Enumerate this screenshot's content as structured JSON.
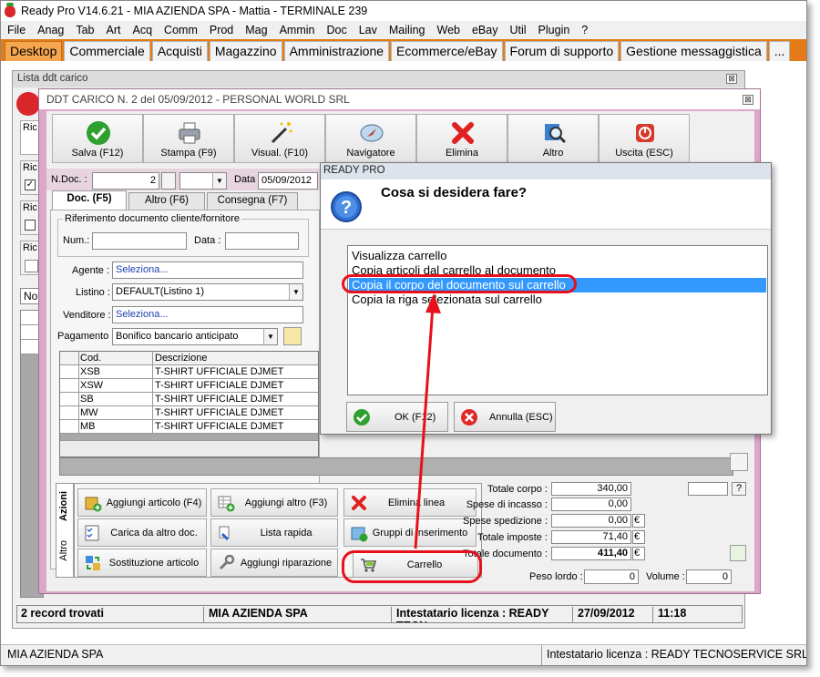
{
  "app": {
    "title": "Ready Pro V14.6.21 - MIA AZIENDA SPA - Mattia - TERMINALE 239",
    "menu": [
      "File",
      "Anag",
      "Tab",
      "Art",
      "Acq",
      "Comm",
      "Prod",
      "Mag",
      "Ammin",
      "Doc",
      "Lav",
      "Mailing",
      "Web",
      "eBay",
      "Util",
      "Plugin",
      "?"
    ],
    "tabs": [
      "Desktop",
      "Commerciale",
      "Acquisti",
      "Magazzino",
      "Amministrazione",
      "Ecommerce/eBay",
      "Forum di supporto",
      "Gestione messaggistica",
      "..."
    ],
    "bottom_company": "MIA AZIENDA SPA",
    "bottom_license": "Intestatario licenza : READY TECNOSERVICE SRL"
  },
  "lista": {
    "title": "Lista ddt carico",
    "filter_labels": [
      "Ric",
      "Ric",
      "Ric",
      "Ric"
    ],
    "no_label": "No",
    "status": {
      "records": "2 record trovati",
      "company": "MIA AZIENDA SPA",
      "license": "Intestatario licenza : READY TECN",
      "date": "27/09/2012",
      "time": "11:18"
    }
  },
  "ddt": {
    "title": "DDT CARICO N. 2  del 05/09/2012 - PERSONAL WORLD SRL",
    "toolbar": {
      "save": "Salva (F12)",
      "print": "Stampa (F9)",
      "visual": "Visual. (F10)",
      "nav": "Navigatore",
      "delete": "Elimina",
      "other": "Altro",
      "exit": "Uscita (ESC)"
    },
    "ndoc_label": "N.Doc. :",
    "ndoc_value": "2",
    "data_label": "Data :",
    "data_value": "05/09/2012",
    "subtabs": [
      "Doc. (F5)",
      "Altro (F6)",
      "Consegna (F7)"
    ],
    "rif_legend": "Riferimento documento cliente/fornitore",
    "num_label": "Num.:",
    "data2_label": "Data :",
    "agente_label": "Agente :",
    "agente_value": "Seleziona...",
    "listino_label": "Listino :",
    "listino_value": "DEFAULT(Listino 1)",
    "venditore_label": "Venditore :",
    "venditore_value": "Seleziona...",
    "pagamento_label": "Pagamento :",
    "pagamento_value": "Bonifico bancario anticipato",
    "grid": {
      "headers": [
        "Cod.",
        "Descrizione"
      ],
      "rows": [
        {
          "cod": "XSB",
          "desc": "T-SHIRT UFFICIALE DJMET"
        },
        {
          "cod": "XSW",
          "desc": "T-SHIRT UFFICIALE DJMET"
        },
        {
          "cod": "SB",
          "desc": "T-SHIRT UFFICIALE DJMET"
        },
        {
          "cod": "MW",
          "desc": "T-SHIRT UFFICIALE DJMET"
        },
        {
          "cod": "MB",
          "desc": "T-SHIRT UFFICIALE DJMET"
        }
      ]
    },
    "side_tabs": [
      "Azioni",
      "Altro"
    ],
    "actions": {
      "add_article": "Aggiungi articolo (F4)",
      "add_other": "Aggiungi altro (F3)",
      "delete_line": "Elimina linea",
      "load_other": "Carica da altro doc.",
      "quick_list": "Lista rapida",
      "groups": "Gruppi di inserimento",
      "replace": "Sostituzione articolo",
      "repair": "Aggiungi riparazione",
      "cart": "Carrello"
    },
    "totals": {
      "corpo_label": "Totale corpo :",
      "corpo": "340,00",
      "incasso_label": "Spese di incasso :",
      "incasso": "0,00",
      "spedizione_label": "Spese spedizione :",
      "spedizione": "0,00",
      "imposte_label": "Totale imposte :",
      "imposte": "71,40",
      "documento_label": "Totale documento :",
      "documento": "411,40",
      "currency": "€",
      "help": "?",
      "peso_label": "Peso lordo :",
      "peso": "0",
      "volume_label": "Volume :",
      "volume": "0"
    }
  },
  "dialog": {
    "title": "READY PRO",
    "question": "Cosa si desidera fare?",
    "options": [
      "Visualizza carrello",
      "Copia articoli dal carrello al documento",
      "Copia il corpo del documento sul carrello",
      "Copia la riga selezionata sul carrello"
    ],
    "selected_index": 2,
    "ok": "OK (F12)",
    "cancel": "Annulla (ESC)"
  },
  "colors": {
    "tabbar": "#e47b16",
    "ddt_frame": "#dba8c9",
    "selection": "#3399ff",
    "highlight": "#e8101a"
  }
}
